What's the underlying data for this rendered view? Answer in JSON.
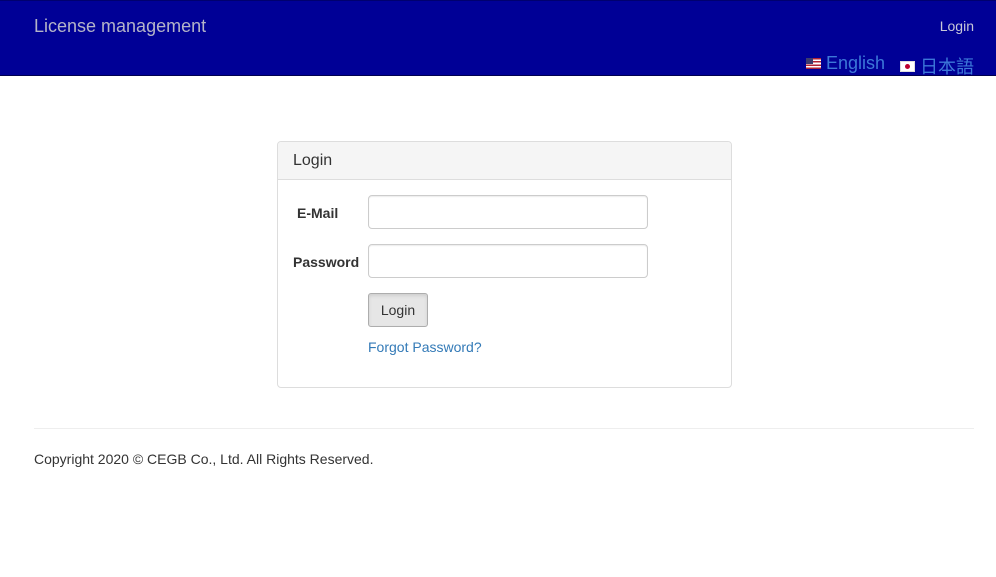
{
  "navbar": {
    "brand": "License management",
    "login_link": "Login",
    "languages": [
      {
        "label": "English",
        "flag": "us-flag-icon"
      },
      {
        "label": "日本語",
        "flag": "jp-flag-icon"
      }
    ],
    "background_color": "#000096"
  },
  "login_panel": {
    "heading": "Login",
    "email_label": "E-Mail",
    "email_value": "",
    "password_label": "Password",
    "password_value": "",
    "submit_label": "Login",
    "forgot_link": "Forgot Password?"
  },
  "footer": {
    "copyright": "Copyright 2020 © CEGB Co., Ltd. All Rights Reserved."
  },
  "colors": {
    "link": "#337ab7",
    "language_link": "#3c78d8"
  }
}
